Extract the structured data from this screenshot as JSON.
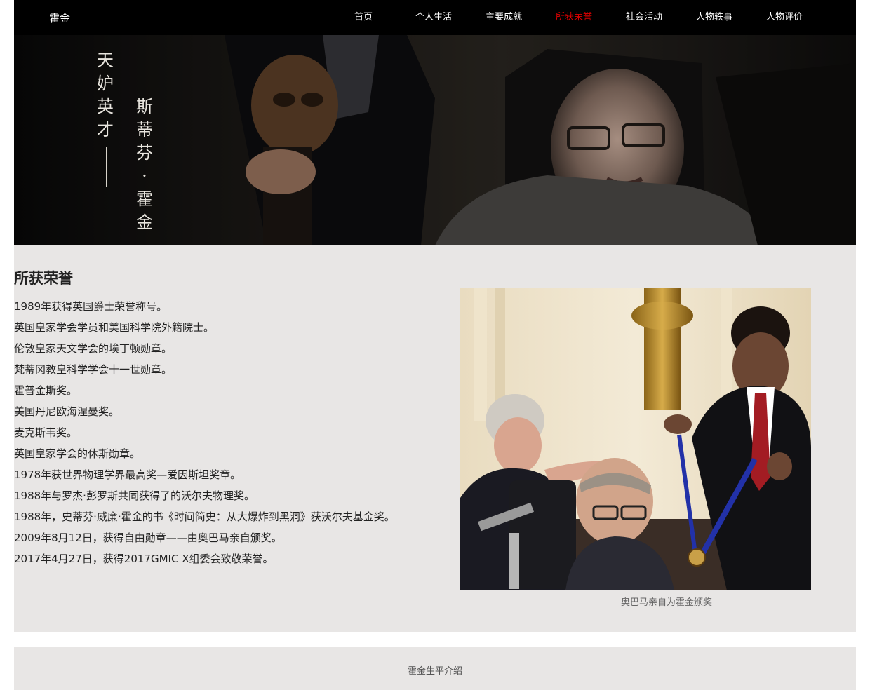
{
  "nav": {
    "brand": "霍金",
    "items": [
      {
        "label": "首页"
      },
      {
        "label": "个人生活"
      },
      {
        "label": "主要成就"
      },
      {
        "label": "所获荣誉"
      },
      {
        "label": "社会活动"
      },
      {
        "label": "人物轶事"
      },
      {
        "label": "人物评价"
      }
    ],
    "active_index": 3,
    "active_color": "#e10000"
  },
  "banner": {
    "line1": [
      "天",
      "妒",
      "英",
      "才"
    ],
    "line2": [
      "斯",
      "蒂",
      "芬",
      "·",
      "霍",
      "金"
    ]
  },
  "content": {
    "title": "所获荣誉",
    "honors": [
      "1989年获得英国爵士荣誉称号。",
      "英国皇家学会学员和美国科学院外籍院士。",
      "伦敦皇家天文学会的埃丁顿勋章。",
      "梵蒂冈教皇科学学会十一世勋章。",
      "霍普金斯奖。",
      "美国丹尼欧海涅曼奖。",
      "麦克斯韦奖。",
      "英国皇家学会的休斯勋章。",
      "1978年获世界物理学界最高奖—爱因斯坦奖章。",
      "1988年与罗杰·彭罗斯共同获得了的沃尔夫物理奖。",
      "1988年，史蒂芬·威廉·霍金的书《时间简史：从大爆炸到黑洞》获沃尔夫基金奖。",
      "2009年8月12日，获得自由勋章——由奥巴马亲自颁奖。",
      "2017年4月27日，获得2017GMIC X组委会致敬荣誉。"
    ],
    "photo_caption": "奥巴马亲自为霍金颁奖"
  },
  "footer": {
    "text": "霍金生平介绍"
  }
}
